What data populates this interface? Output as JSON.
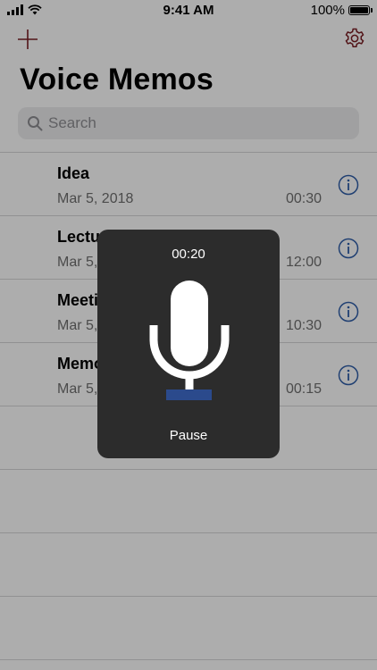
{
  "status_bar": {
    "time": "9:41 AM",
    "battery": "100%"
  },
  "header": {
    "title": "Voice Memos"
  },
  "search": {
    "placeholder": "Search"
  },
  "memos": [
    {
      "name": "Idea",
      "date": "Mar 5, 2018",
      "duration": "00:30"
    },
    {
      "name": "Lecture",
      "date": "Mar 5, 2018",
      "duration": "12:00"
    },
    {
      "name": "Meeting",
      "date": "Mar 5, 2018",
      "duration": "10:30"
    },
    {
      "name": "Memo",
      "date": "Mar 5, 2018",
      "duration": "00:15"
    }
  ],
  "recording_hud": {
    "elapsed": "00:20",
    "action_label": "Pause"
  },
  "colors": {
    "accent": "#7a1e24",
    "info": "#2f5da8",
    "mic_bar": "#2b4a8c",
    "hud_bg": "#2c2c2c"
  },
  "icons": {
    "add": "plus-icon",
    "settings": "gear-icon",
    "search": "search-icon",
    "info": "info-icon",
    "mic": "microphone-icon"
  }
}
